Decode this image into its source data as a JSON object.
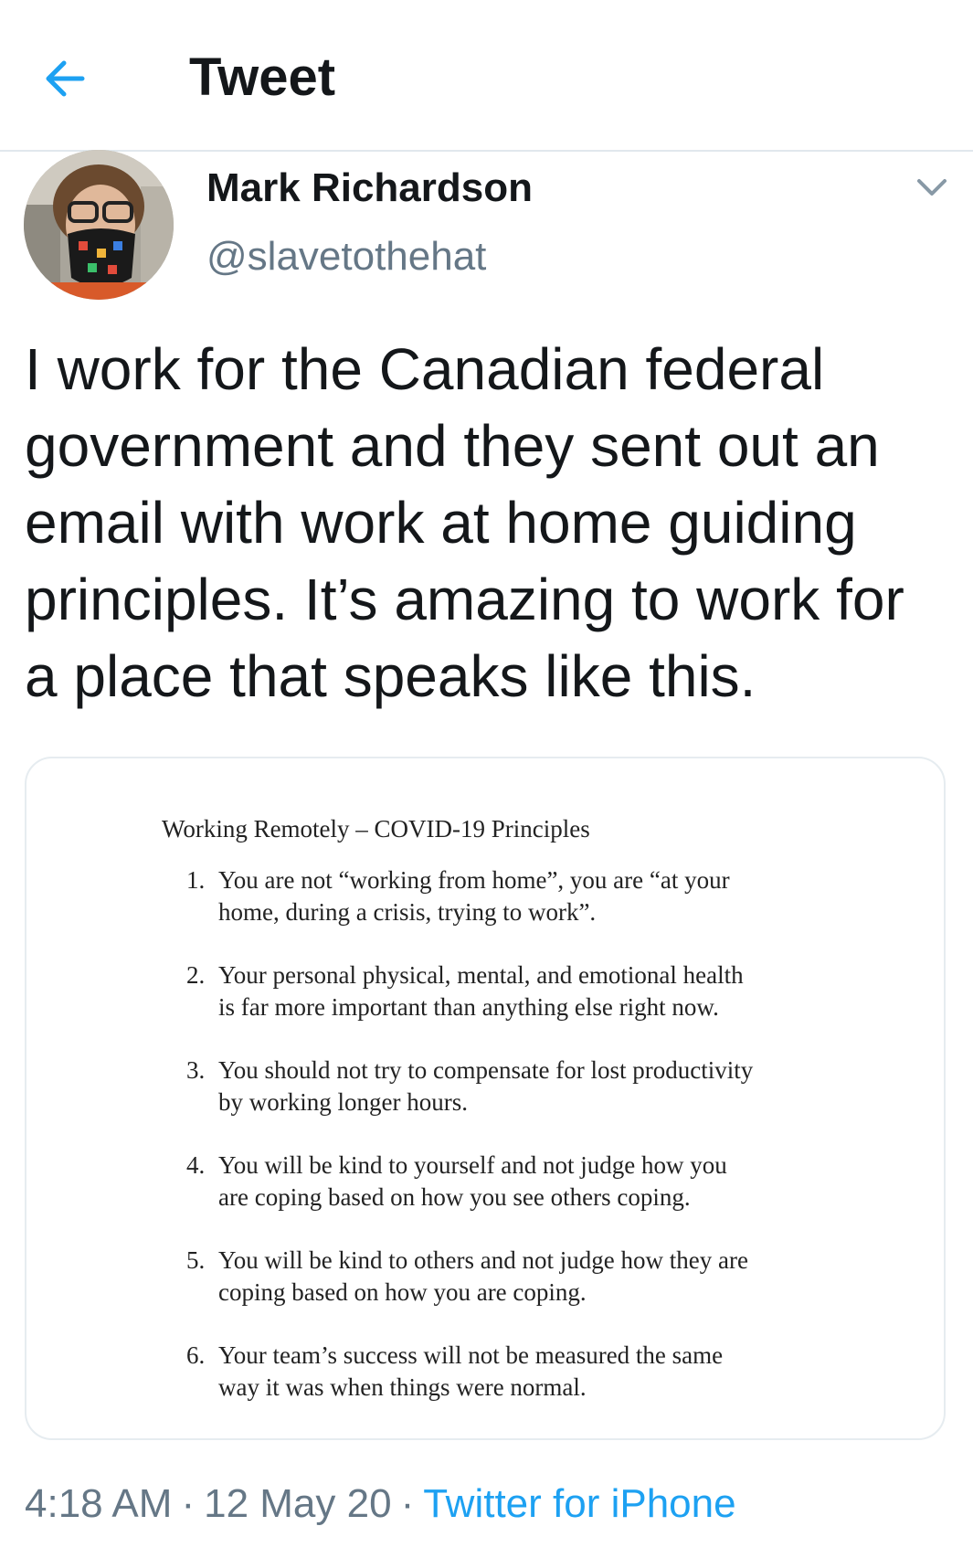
{
  "header": {
    "title": "Tweet",
    "accent": "#1da1f2"
  },
  "author": {
    "display_name": "Mark Richardson",
    "handle": "@slavetothehat"
  },
  "tweet": {
    "text": "I work for the Canadian federal\ngovernment and they sent out an\nemail with work at home guiding\nprinciples. It’s amazing to work for\na place that speaks like this."
  },
  "media": {
    "title": "Working Remotely – COVID-19 Principles",
    "principles": [
      {
        "num": "1.",
        "line1": "You are not “working from home”, you are “at your",
        "line2": "home, during a crisis, trying to work”."
      },
      {
        "num": "2.",
        "line1": "Your personal physical, mental, and emotional health",
        "line2": "is far more important than anything else right now."
      },
      {
        "num": "3.",
        "line1": "You should not try to compensate for lost productivity",
        "line2": "by working longer hours."
      },
      {
        "num": "4.",
        "line1": "You will be kind to yourself and not judge how you",
        "line2": "are coping based on how you see others coping."
      },
      {
        "num": "5.",
        "line1": "You will be kind to others and not judge how they are",
        "line2": "coping based on how you are coping."
      },
      {
        "num": "6.",
        "line1": "Your team’s success will not be measured the same",
        "line2": "way it was when things were normal."
      }
    ]
  },
  "meta": {
    "time": "4:18 AM",
    "separator": "·",
    "date": "12 May 20",
    "source": "Twitter for iPhone"
  },
  "icons": {
    "back": "arrow-left-icon",
    "caret": "chevron-down-icon"
  }
}
